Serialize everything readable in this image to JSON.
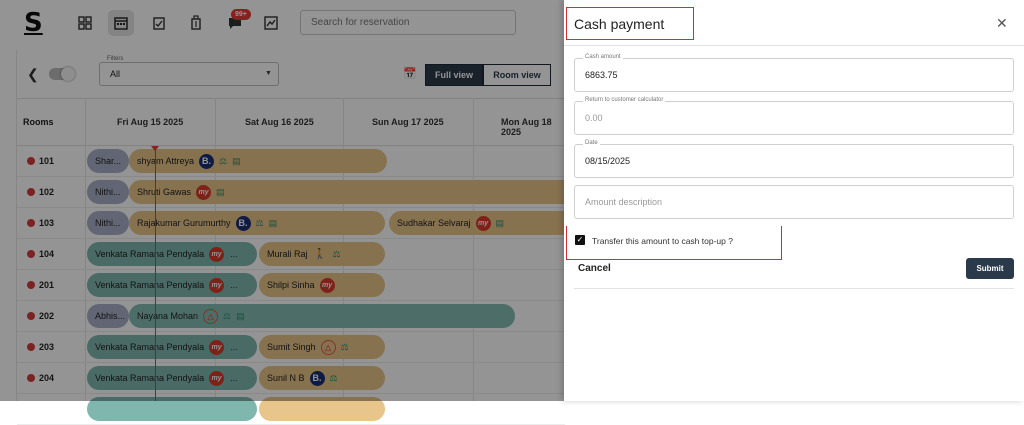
{
  "app": {
    "logo": "S",
    "badge": "99+",
    "search_placeholder": "Search for reservation"
  },
  "toolbar": {
    "filters_label": "Filters",
    "filters_value": "All",
    "full_view": "Full view",
    "room_view": "Room view"
  },
  "grid": {
    "rooms_header": "Rooms",
    "dates": [
      "Fri Aug 15 2025",
      "Sat Aug 16 2025",
      "Sun Aug 17 2025",
      "Mon Aug 18 2025"
    ],
    "rows": [
      {
        "room": "101"
      },
      {
        "room": "102"
      },
      {
        "room": "103"
      },
      {
        "room": "104"
      },
      {
        "room": "201"
      },
      {
        "room": "202"
      },
      {
        "room": "203"
      },
      {
        "room": "204"
      }
    ],
    "bookings": {
      "r101_a": "Shar...",
      "r101_b": "shyam Attreya",
      "r102_a": "Nithi...",
      "r102_b": "Shruti Gawas",
      "r103_a": "Nithi...",
      "r103_b": "Rajakumar Gurumurthy",
      "r103_c": "Sudhakar Selvaraj",
      "r104_a": "Venkata Ramana Pendyala",
      "r104_b": "Murali Raj",
      "r201_a": "Venkata Ramana Pendyala",
      "r201_b": "Shilpi Sinha",
      "r202_a": "Abhis...",
      "r202_b": "Nayana Mohan",
      "r203_a": "Venkata Ramana Pendyala",
      "r203_b": "Sumit Singh",
      "r204_a": "Venkata Ramana Pendyala",
      "r204_b": "Sunil N B",
      "ellipsis": "..."
    },
    "channel_icons": {
      "booking": "B.",
      "mmt": "my",
      "airbnb": "airbnb-icon",
      "walkin": "walk-in-icon"
    }
  },
  "drawer": {
    "title": "Cash payment",
    "cash_amount_label": "Cash amount",
    "cash_amount_value": "6863.75",
    "return_label": "Return to customer calculator",
    "return_value": "0.00",
    "date_label": "Date",
    "date_value": "08/15/2025",
    "description_placeholder": "Amount description",
    "transfer_label": "Transfer this amount to cash top-up ?",
    "transfer_checked": true,
    "cancel_label": "Cancel",
    "submit_label": "Submit"
  },
  "colors": {
    "accent": "#2b3a4b",
    "highlight": "#d32f2f",
    "tan": "#e8c58a",
    "teal": "#7fb7ae",
    "grey": "#a9b0c8"
  }
}
